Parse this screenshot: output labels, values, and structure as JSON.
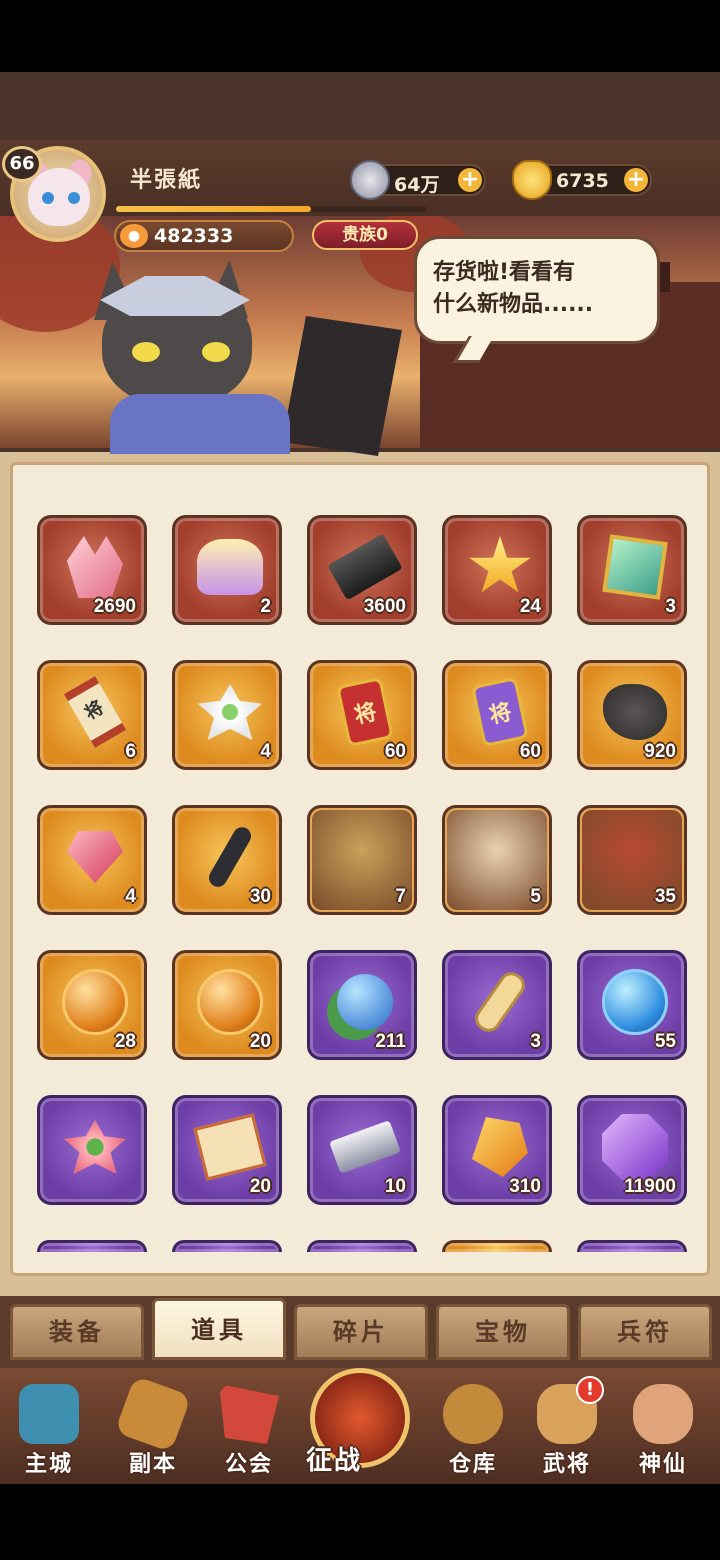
{
  "player": {
    "level": "66",
    "name": "半張紙",
    "exp_fraction": 0.63,
    "paw_points": "482333",
    "noble": "贵族0"
  },
  "currencies": {
    "coins": "64万",
    "gold": "6735"
  },
  "npc": {
    "speech": "存货啦!看看有\n什么新物品......"
  },
  "inventory": {
    "items": [
      {
        "name": "crystal-icon",
        "qty": "2690",
        "rarity": "red",
        "art": "a-crystal"
      },
      {
        "name": "helmet-icon",
        "qty": "2",
        "rarity": "red",
        "art": "a-helm"
      },
      {
        "name": "iron-ingot-icon",
        "qty": "3600",
        "rarity": "red",
        "art": "a-ingot-dark"
      },
      {
        "name": "star-icon",
        "qty": "24",
        "rarity": "red",
        "art": "a-star"
      },
      {
        "name": "jade-box-icon",
        "qty": "3",
        "rarity": "red",
        "art": "a-box"
      },
      {
        "name": "general-scroll-icon",
        "qty": "6",
        "rarity": "orange",
        "art": "a-scroll",
        "glyph": "将"
      },
      {
        "name": "white-lotus-icon",
        "qty": "4",
        "rarity": "orange",
        "art": "a-lotus-w"
      },
      {
        "name": "red-general-token-icon",
        "qty": "60",
        "rarity": "orange",
        "art": "a-token red",
        "glyph": "将"
      },
      {
        "name": "purple-general-token-icon",
        "qty": "60",
        "rarity": "orange",
        "art": "a-token purple",
        "glyph": "将"
      },
      {
        "name": "rune-stone-icon",
        "qty": "920",
        "rarity": "orange",
        "art": "a-ore"
      },
      {
        "name": "red-gem-icon",
        "qty": "4",
        "rarity": "orange",
        "art": "a-gem-r"
      },
      {
        "name": "hook-icon",
        "qty": "30",
        "rarity": "orange",
        "art": "a-hook"
      },
      {
        "name": "hero-fragment-portrait",
        "qty": "7",
        "rarity": "orange",
        "art": "a-portrait",
        "color": "#c9a25a"
      },
      {
        "name": "hero-fragment-portrait",
        "qty": "5",
        "rarity": "orange",
        "art": "a-portrait",
        "color": "#e8d2b2"
      },
      {
        "name": "hero-fragment-portrait",
        "qty": "35",
        "rarity": "orange",
        "art": "a-portrait",
        "color": "#b84a32"
      },
      {
        "name": "fire-orb-icon",
        "qty": "28",
        "rarity": "orange",
        "art": "a-orb-o"
      },
      {
        "name": "swirl-orb-icon",
        "qty": "20",
        "rarity": "orange",
        "art": "a-orb-o"
      },
      {
        "name": "leaf-orb-icon",
        "qty": "211",
        "rarity": "purple",
        "art": "a-orb-leaf"
      },
      {
        "name": "yellow-scroll-icon",
        "qty": "3",
        "rarity": "purple",
        "art": "a-scroll-y"
      },
      {
        "name": "water-orb-icon",
        "qty": "55",
        "rarity": "purple",
        "art": "a-orb-b"
      },
      {
        "name": "pink-lotus-icon",
        "qty": "",
        "rarity": "purple",
        "art": "a-lotus-p"
      },
      {
        "name": "edict-paper-icon",
        "qty": "20",
        "rarity": "purple",
        "art": "a-paper"
      },
      {
        "name": "silver-ingot-icon",
        "qty": "10",
        "rarity": "purple",
        "art": "a-ingot-s"
      },
      {
        "name": "amber-stone-icon",
        "qty": "310",
        "rarity": "purple",
        "art": "a-amber"
      },
      {
        "name": "purple-gem-icon",
        "qty": "11900",
        "rarity": "purple",
        "art": "a-gem-p"
      }
    ],
    "partial_row": [
      "purple",
      "purple",
      "purple",
      "orange",
      "purple"
    ]
  },
  "tabs": [
    {
      "label": "装备",
      "active": false
    },
    {
      "label": "道具",
      "active": true
    },
    {
      "label": "碎片",
      "active": false
    },
    {
      "label": "宝物",
      "active": false
    },
    {
      "label": "兵符",
      "active": false
    }
  ],
  "nav": [
    {
      "label": "主城",
      "icon": "castle-icon",
      "color": "#3f8fb0"
    },
    {
      "label": "副本",
      "icon": "swords-icon",
      "color": "#c98b3a"
    },
    {
      "label": "公会",
      "icon": "guild-flag-icon",
      "color": "#d2483a"
    },
    {
      "label": "征战",
      "icon": "battle-icon",
      "center": true
    },
    {
      "label": "仓库",
      "icon": "treasure-bag-icon",
      "color": "#c48a3c"
    },
    {
      "label": "武将",
      "icon": "general-cat-icon",
      "color": "#d9a25c",
      "badge": "!"
    },
    {
      "label": "神仙",
      "icon": "immortal-cat-icon",
      "color": "#e0a47a"
    }
  ]
}
